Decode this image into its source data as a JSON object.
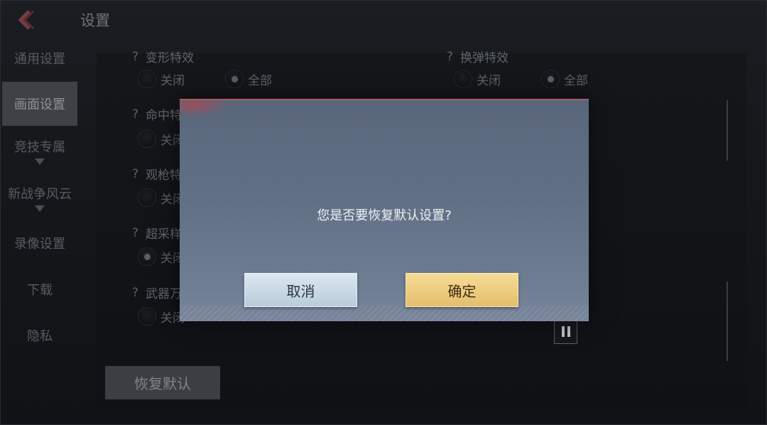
{
  "header": {
    "title": "设置",
    "back_icon": "chevron-left-icon"
  },
  "sidebar": {
    "items": [
      {
        "label": "通用设置",
        "active": false,
        "has_arrow": false
      },
      {
        "label": "画面设置",
        "active": true,
        "has_arrow": false
      },
      {
        "label": "竞技专属",
        "active": false,
        "has_arrow": true
      },
      {
        "label": "新战争风云",
        "active": false,
        "has_arrow": true
      },
      {
        "label": "录像设置",
        "active": false,
        "has_arrow": false
      },
      {
        "label": "下载",
        "active": false,
        "has_arrow": false
      },
      {
        "label": "隐私",
        "active": false,
        "has_arrow": false
      }
    ]
  },
  "options": {
    "opt1": {
      "title": "变形特效",
      "off": "关闭",
      "all": "全部",
      "selected": "all"
    },
    "opt2": {
      "title": "换弹特效",
      "off": "关闭",
      "all": "全部",
      "selected": "all"
    },
    "opt3": {
      "title": "命中特",
      "off": "关闭"
    },
    "opt4": {
      "title": "观枪特",
      "off": "关闭"
    },
    "opt5": {
      "title": "超采样",
      "off": "关闭",
      "selected": "off"
    },
    "opt6": {
      "title": "武器万",
      "off": "关闭"
    },
    "help_glyph": "?"
  },
  "restore_button": "恢复默认",
  "pause_icon": "pause-icon",
  "dialog": {
    "message": "您是否要恢复默认设置?",
    "cancel": "取消",
    "confirm": "确定"
  },
  "colors": {
    "dialog_top": "#59667a",
    "cancel_btn": "#c7d7e4",
    "confirm_btn": "#ecc97c",
    "active_tab": "#3e4145"
  }
}
